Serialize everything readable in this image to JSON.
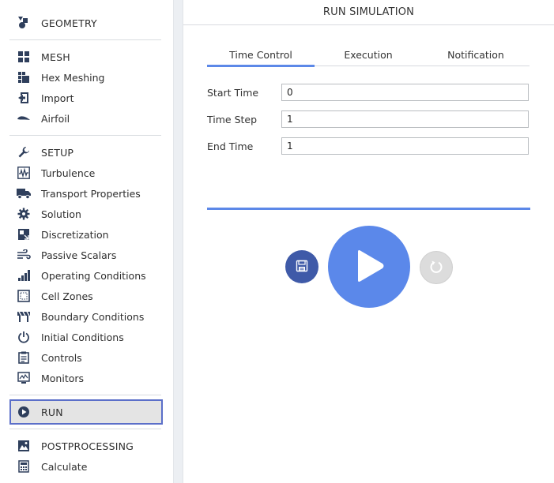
{
  "sidebar": {
    "geometry": "GEOMETRY",
    "mesh": "MESH",
    "hex_meshing": "Hex Meshing",
    "import": "Import",
    "airfoil": "Airfoil",
    "setup": "SETUP",
    "turbulence": "Turbulence",
    "transport": "Transport Properties",
    "solution": "Solution",
    "discretization": "Discretization",
    "passive_scalars": "Passive Scalars",
    "operating_conditions": "Operating Conditions",
    "cell_zones": "Cell Zones",
    "boundary_conditions": "Boundary Conditions",
    "initial_conditions": "Initial Conditions",
    "controls": "Controls",
    "monitors": "Monitors",
    "run": "RUN",
    "postprocessing": "POSTPROCESSING",
    "calculate": "Calculate"
  },
  "panel": {
    "title": "RUN SIMULATION",
    "tabs": [
      "Time Control",
      "Execution",
      "Notification"
    ],
    "active_tab": "Time Control",
    "fields": {
      "start_time_label": "Start Time",
      "start_time_value": "0",
      "time_step_label": "Time Step",
      "time_step_value": "1",
      "end_time_label": "End Time",
      "end_time_value": "1"
    }
  },
  "colors": {
    "icon": "#2f3f5c",
    "accent": "#5b88ea",
    "save_button": "#3f5aa8",
    "reset_button": "#dcdcdc",
    "active_border": "#5b6fc9"
  },
  "icons": {
    "geometry": "shapes-icon",
    "mesh": "grid-icon",
    "hex_meshing": "hex-mesh-icon",
    "import": "import-icon",
    "airfoil": "airfoil-icon",
    "setup": "wrench-icon",
    "turbulence": "waveform-icon",
    "transport": "truck-icon",
    "solution": "gear-icon",
    "discretization": "discretization-icon",
    "passive_scalars": "wind-icon",
    "operating_conditions": "bar-chart-icon",
    "cell_zones": "dotted-square-icon",
    "boundary_conditions": "barrier-icon",
    "initial_conditions": "power-icon",
    "controls": "clipboard-icon",
    "monitors": "monitor-icon",
    "run": "play-circle-icon",
    "postprocessing": "image-icon",
    "calculate": "calculator-icon",
    "save": "floppy-disk-icon",
    "play": "play-icon",
    "reset": "refresh-icon"
  }
}
